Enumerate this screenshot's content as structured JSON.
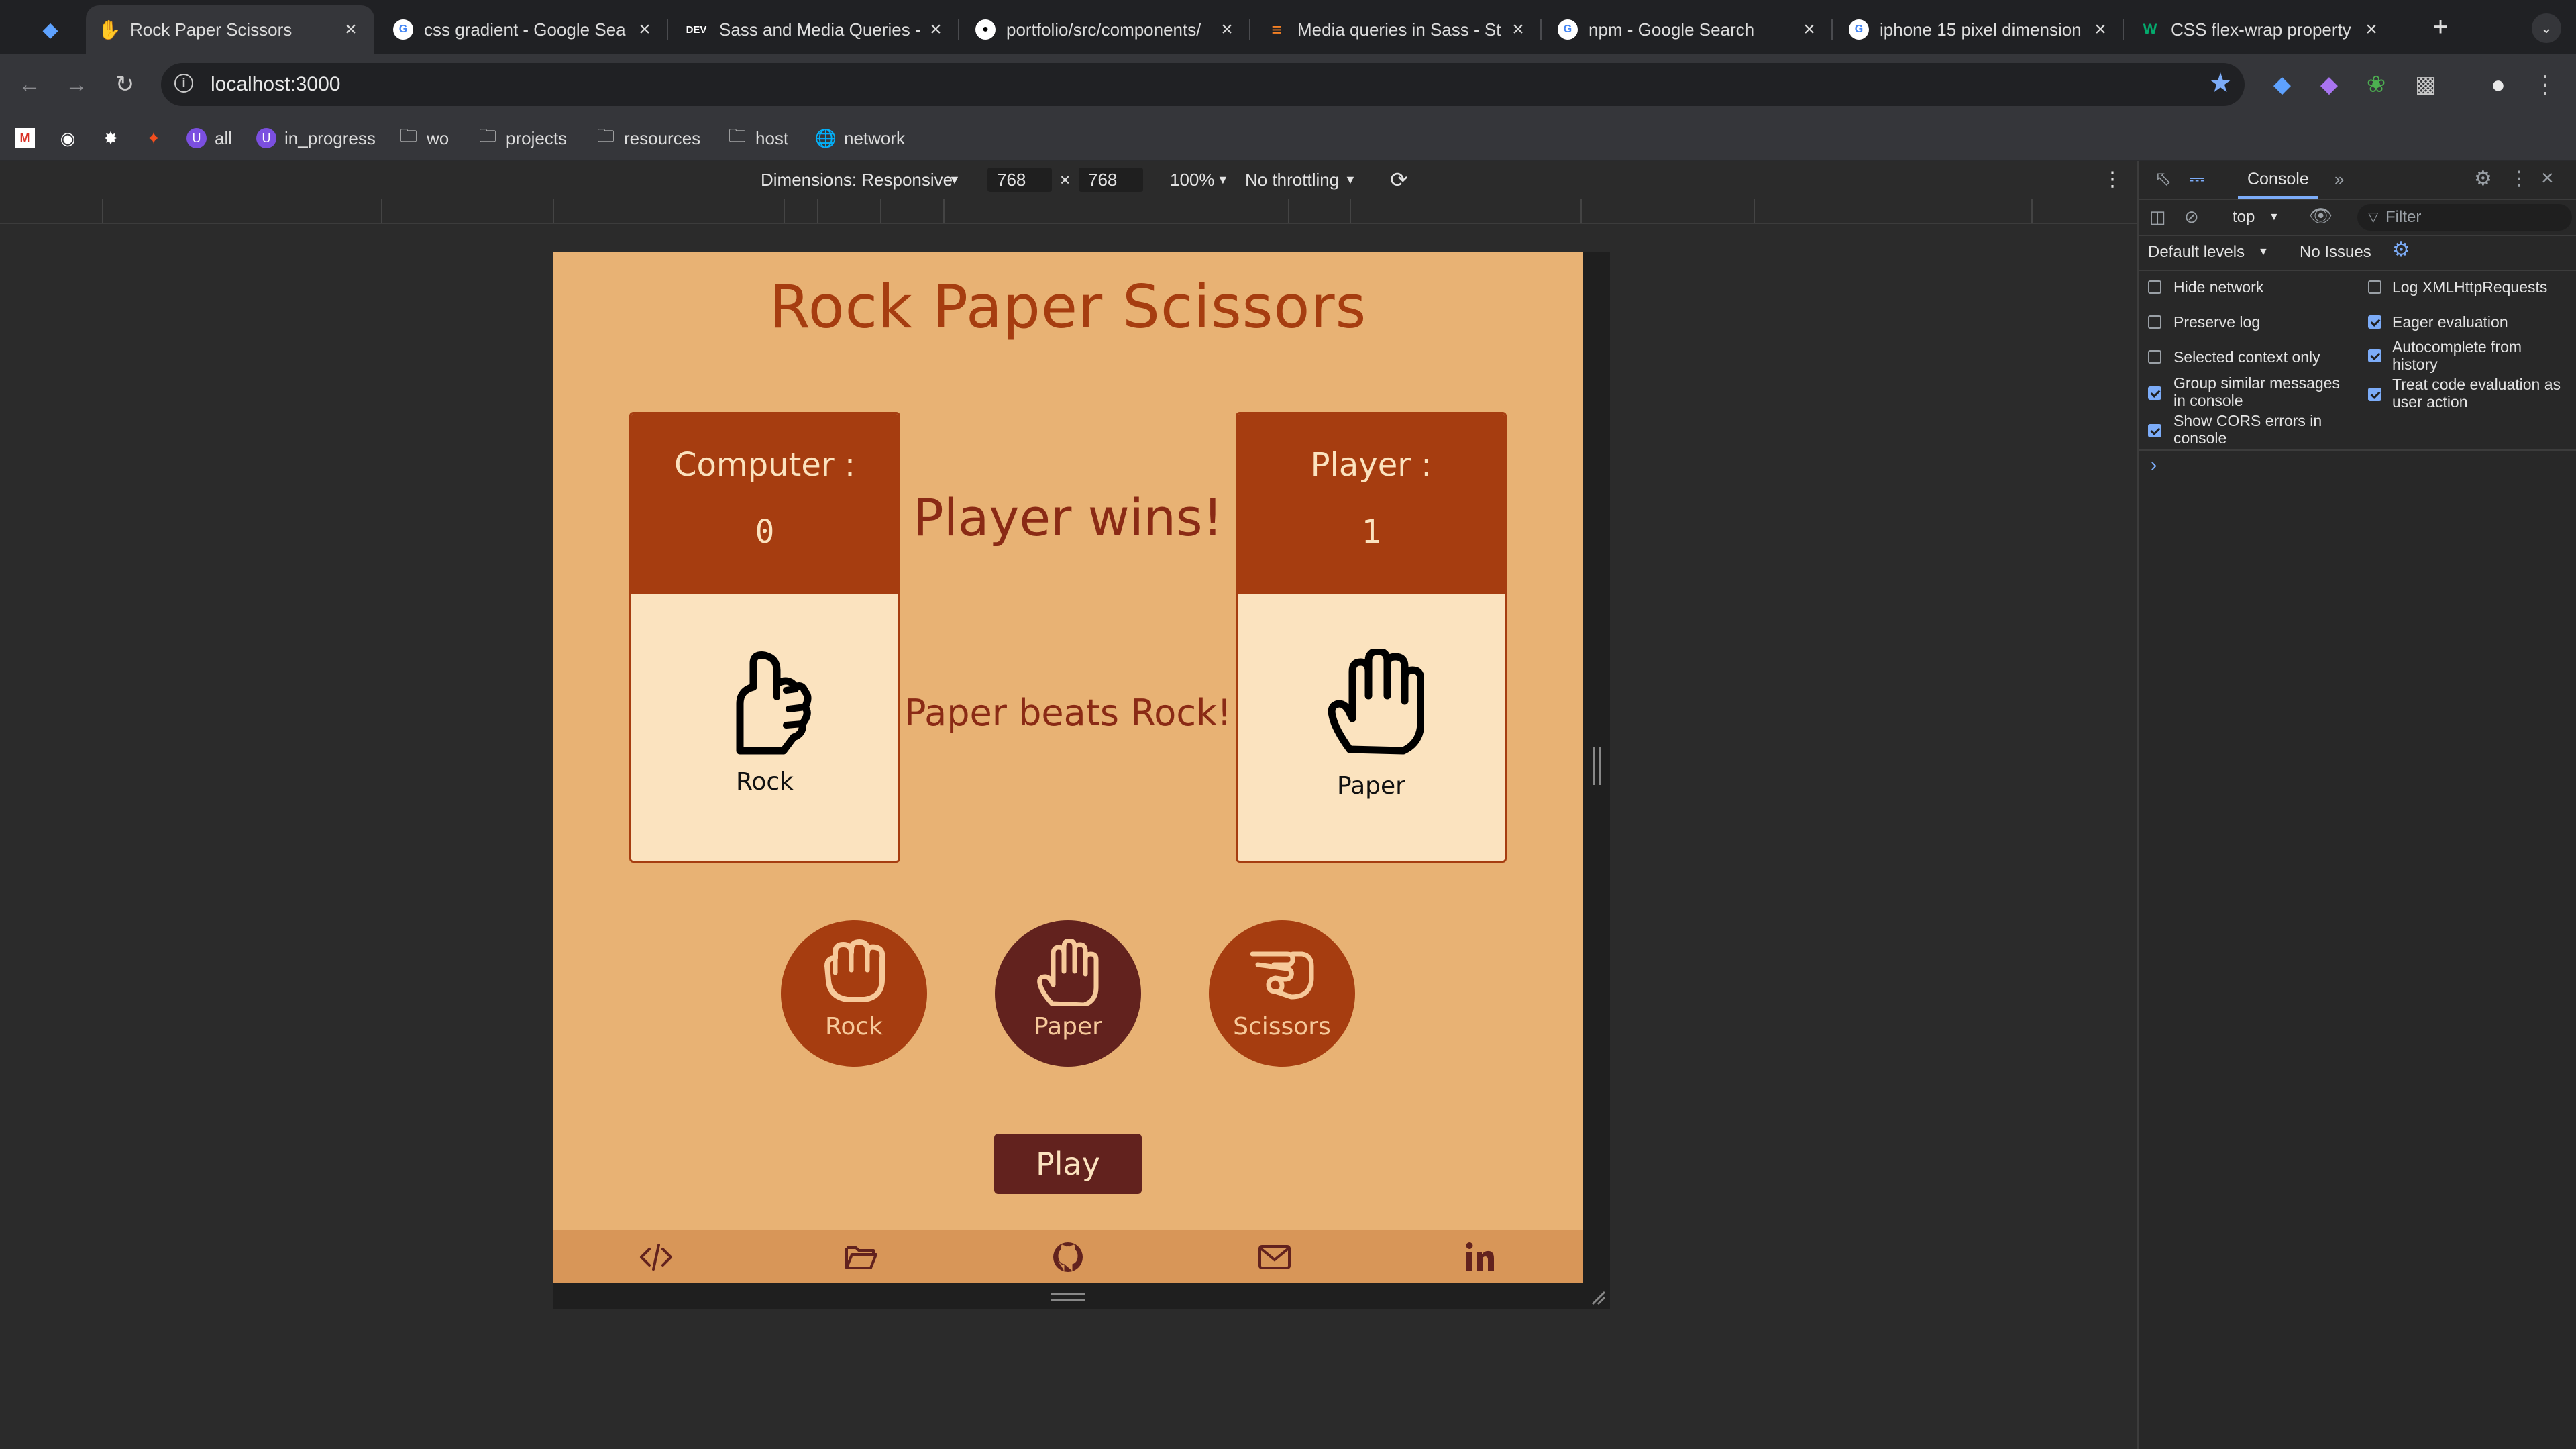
{
  "tabs": [
    {
      "title": "",
      "favicon": "gem-icon",
      "x": 0
    },
    {
      "title": "Rock Paper Scissors",
      "favicon": "hand-icon",
      "active": true
    },
    {
      "title": "css gradient - Google Sea",
      "favicon": "google-icon"
    },
    {
      "title": "Sass and Media Queries -",
      "favicon": "dev-icon"
    },
    {
      "title": "portfolio/src/components/",
      "favicon": "github-icon"
    },
    {
      "title": "Media queries in Sass - St",
      "favicon": "stackoverflow-icon"
    },
    {
      "title": "npm - Google Search",
      "favicon": "google-icon"
    },
    {
      "title": "iphone 15 pixel dimension",
      "favicon": "google-icon"
    },
    {
      "title": "CSS flex-wrap property",
      "favicon": "w3-icon"
    }
  ],
  "address": {
    "url": "localhost:3000"
  },
  "bookmarks": [
    {
      "label": ""
    },
    {
      "label": ""
    },
    {
      "label": ""
    },
    {
      "label": ""
    },
    {
      "label": "all"
    },
    {
      "label": "in_progress"
    },
    {
      "label": "wo"
    },
    {
      "label": "projects"
    },
    {
      "label": "resources"
    },
    {
      "label": "host"
    },
    {
      "label": "network"
    }
  ],
  "device_toolbar": {
    "dimensions": "Dimensions: Responsive",
    "width": "768",
    "height": "768",
    "times": "×",
    "zoom": "100%",
    "throttling": "No throttling"
  },
  "app": {
    "title": "Rock Paper Scissors",
    "computer": {
      "label": "Computer :",
      "score": "0",
      "choice": "Rock",
      "choice_icon": "fist-icon"
    },
    "player": {
      "label": "Player :",
      "score": "1",
      "choice": "Paper",
      "choice_icon": "open-hand-icon"
    },
    "result": "Player wins!",
    "explanation": "Paper beats Rock!",
    "choices": [
      {
        "label": "Rock",
        "color": "#a63d10",
        "icon": "fist-icon"
      },
      {
        "label": "Paper",
        "color": "#62221e",
        "icon": "open-hand-icon"
      },
      {
        "label": "Scissors",
        "color": "#a63d10",
        "icon": "scissors-hand-icon"
      }
    ],
    "play_label": "Play",
    "footer_icons": [
      "code-icon",
      "folder-icon",
      "github-icon",
      "mail-icon",
      "linkedin-icon"
    ]
  },
  "devtools": {
    "tab": "Console",
    "context": "top",
    "filter_placeholder": "Filter",
    "levels": "Default levels",
    "issues": "No Issues",
    "settings_left": [
      {
        "label": "Hide network",
        "checked": false
      },
      {
        "label": "Preserve log",
        "checked": false
      },
      {
        "label": "Selected context only",
        "checked": false
      },
      {
        "label": "Group similar messages in console",
        "checked": true
      },
      {
        "label": "Show CORS errors in console",
        "checked": true
      }
    ],
    "settings_right": [
      {
        "label": "Log XMLHttpRequests",
        "checked": false
      },
      {
        "label": "Eager evaluation",
        "checked": true
      },
      {
        "label": "Autocomplete from history",
        "checked": true
      },
      {
        "label": "Treat code evaluation as user action",
        "checked": true
      }
    ],
    "prompt": "›"
  },
  "colors": {
    "app_bg": "#e8b274",
    "primary": "#a63d10",
    "dark": "#62221e",
    "card_bg": "#fbe3bf",
    "footer": "#d89658"
  }
}
